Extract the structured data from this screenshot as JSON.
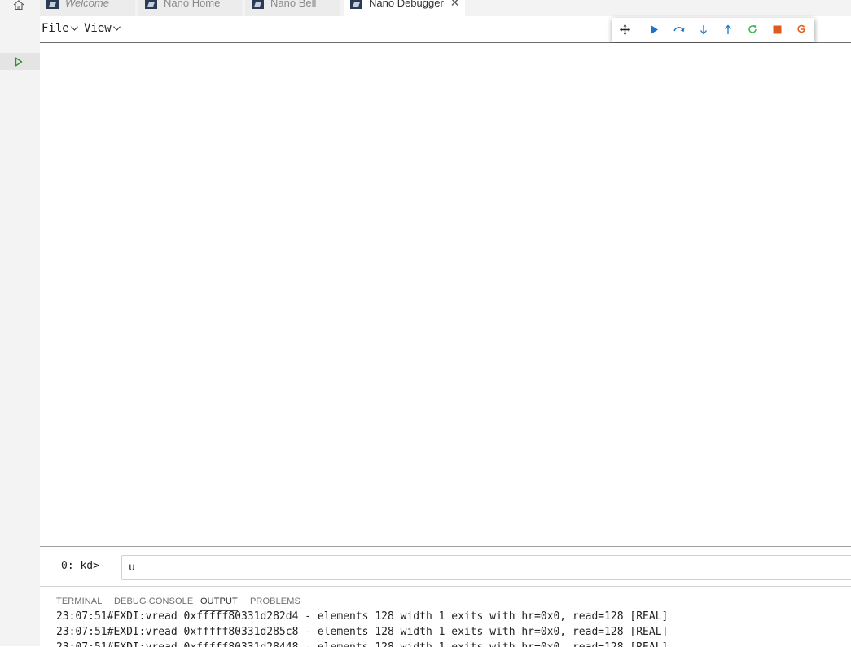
{
  "tabs": [
    {
      "label": "Welcome",
      "italic": true,
      "active": false
    },
    {
      "label": "Nano Home",
      "italic": false,
      "active": false
    },
    {
      "label": "Nano Bell",
      "italic": false,
      "active": false
    },
    {
      "label": "Nano Debugger",
      "italic": false,
      "active": true
    }
  ],
  "menus": {
    "file": "File",
    "view": "View"
  },
  "toolbar_icons": [
    "move-handle-icon",
    "continue-icon",
    "step-over-icon",
    "step-into-icon",
    "step-out-icon",
    "restart-icon",
    "stop-icon",
    "disconnect-icon"
  ],
  "command": {
    "prompt": "0: kd>",
    "value": "u"
  },
  "panel_tabs": {
    "terminal": "TERMINAL",
    "debug_console": "DEBUG CONSOLE",
    "output": "OUTPUT",
    "problems": "PROBLEMS"
  },
  "output_lines": [
    "23:07:51#EXDI:vread 0xfffff80331d282d4 - elements 128 width 1 exits with hr=0x0, read=128 [REAL]",
    "23:07:51#EXDI:vread 0xfffff80331d285c8 - elements 128 width 1 exits with hr=0x0, read=128 [REAL]",
    "23:07:51#EXDI:vread 0xfffff80331d28448 - elements 128 width 1 exits with hr=0x0, read=128 [REAL]"
  ],
  "colors": {
    "play_blue": "#1a73c8",
    "restart_green": "#3fb950",
    "stop_orange": "#e05a1e",
    "run_green": "#388a34"
  }
}
